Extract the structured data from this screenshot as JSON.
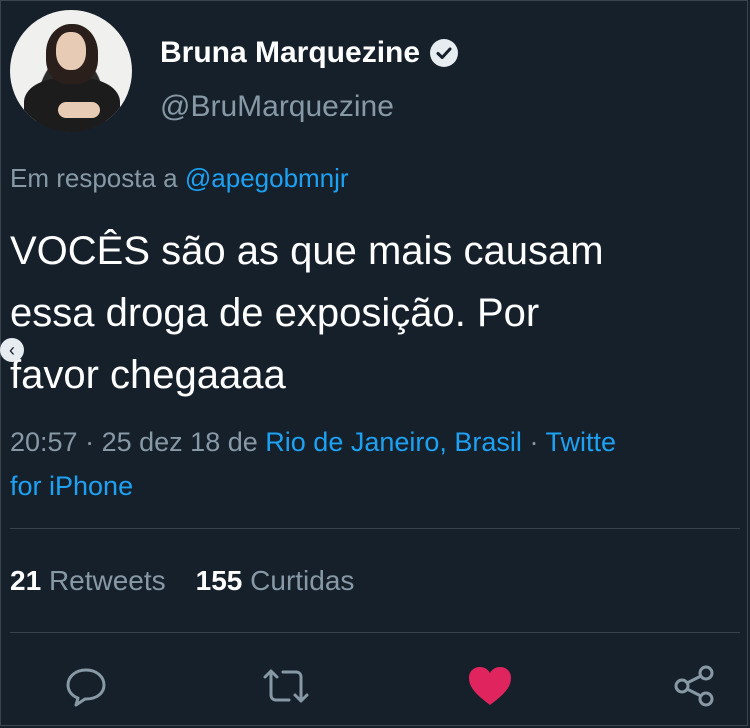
{
  "user": {
    "display_name": "Bruna Marquezine",
    "handle": "@BruMarquezine",
    "verified_icon": "verified-badge-icon"
  },
  "reply": {
    "prefix": "Em resposta a",
    "mention": "@apegobmnjr"
  },
  "tweet": {
    "line1": "VOCÊS são as que mais causam",
    "line2": "essa droga de exposição. Por",
    "line3": "favor chegaaaa"
  },
  "meta": {
    "time": "20:57",
    "date": "25 dez 18",
    "from": "de",
    "location": "Rio de Janeiro, Brasil",
    "client_part1": "Twitte",
    "client_part2": "for iPhone"
  },
  "stats": {
    "retweets_count": "21",
    "retweets_label": "Retweets",
    "likes_count": "155",
    "likes_label": "Curtidas"
  },
  "actions": {
    "reply_icon": "reply-icon",
    "retweet_icon": "retweet-icon",
    "like_icon": "heart-icon",
    "share_icon": "share-icon"
  },
  "colors": {
    "background": "#15202b",
    "accent": "#1da1f2",
    "muted": "#8899a6",
    "like": "#e0245e"
  }
}
